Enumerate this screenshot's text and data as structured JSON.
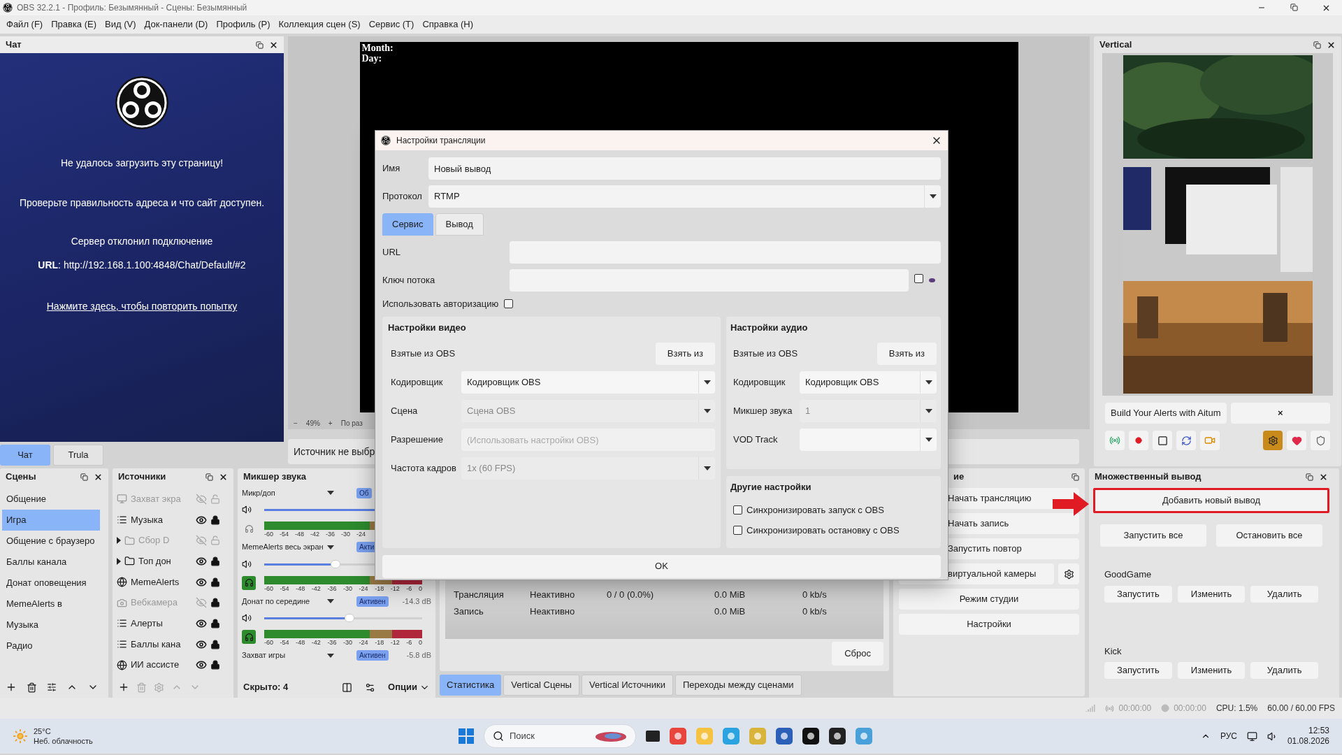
{
  "window": {
    "title": "OBS 32.2.1 - Профиль: Безымянный - Сцены: Безымянный"
  },
  "menu": [
    "Файл (F)",
    "Правка (E)",
    "Вид (V)",
    "Док-панели (D)",
    "Профиль (P)",
    "Коллекция сцен (S)",
    "Сервис (T)",
    "Справка (H)"
  ],
  "chat_dock": {
    "title": "Чат",
    "error_title": "Не удалось загрузить эту страницу!",
    "hint": "Проверьте правильность адреса и что сайт доступен.",
    "error": "Сервер отклонил подключение",
    "url": "**URL**: http://192.168.1.100:4848/Chat/Default/#2",
    "retry_link": "Нажмите здесь, чтобы повторить попытку"
  },
  "dock_tabs": [
    {
      "label": "Чат",
      "selected": true
    },
    {
      "label": "Trula",
      "selected": false
    }
  ],
  "preview": {
    "overlay_lines": [
      "Month:",
      "Day:"
    ],
    "zoom_out": "−",
    "zoom": "49%",
    "zoom_in": "+",
    "fit": "По раз"
  },
  "source_bar": {
    "text": "Источник не выбр"
  },
  "vertical_dock": {
    "title": "Vertical",
    "alerts_button": "Build Your Alerts with Aitum",
    "close_button": "×"
  },
  "scenes": {
    "title": "Сцены",
    "items": [
      {
        "name": "Общение",
        "selected": false
      },
      {
        "name": "Игра",
        "selected": true
      },
      {
        "name": "Общение с браузеро",
        "selected": false
      },
      {
        "name": "Баллы канала",
        "selected": false
      },
      {
        "name": "Донат оповещения",
        "selected": false
      },
      {
        "name": "MemeAlerts в",
        "selected": false
      },
      {
        "name": "Музыка",
        "selected": false
      },
      {
        "name": "Радио",
        "selected": false
      }
    ]
  },
  "sources": {
    "title": "Источники",
    "items": [
      {
        "name": "Захват экра",
        "kind": "display",
        "group": false,
        "visible": false,
        "locked": false
      },
      {
        "name": "Музыка",
        "kind": "list",
        "group": false,
        "visible": true,
        "locked": true
      },
      {
        "name": "Сбор D",
        "kind": "folder",
        "group": true,
        "visible": false,
        "locked": false
      },
      {
        "name": "Топ дон",
        "kind": "folder",
        "group": true,
        "visible": true,
        "locked": true
      },
      {
        "name": "MemeAlerts",
        "kind": "browser",
        "group": false,
        "visible": true,
        "locked": true
      },
      {
        "name": "Вебкамера",
        "kind": "camera",
        "group": false,
        "visible": false,
        "locked": true
      },
      {
        "name": "Алерты",
        "kind": "list",
        "group": false,
        "visible": true,
        "locked": true
      },
      {
        "name": "Баллы кана",
        "kind": "list",
        "group": false,
        "visible": true,
        "locked": true
      },
      {
        "name": "ИИ ассисте",
        "kind": "browser",
        "group": false,
        "visible": true,
        "locked": true
      }
    ]
  },
  "mixer": {
    "title": "Микшер звука",
    "hidden_count": "Скрыто: 4",
    "options": "Опции",
    "channels": [
      {
        "name": "Микр/доп",
        "badge": "Об",
        "level": 1,
        "monitoring": false,
        "scale": [
          "-60",
          "-54",
          "-48",
          "-42",
          "-36",
          "-30",
          "-24"
        ]
      },
      {
        "name": "MemeAlerts весь экран",
        "badge": "Акти",
        "level": 0.45,
        "monitoring": true,
        "scale": [
          "-60",
          "-54",
          "-48",
          "-42",
          "-36",
          "-30",
          "-24",
          "-18",
          "-12",
          "-6",
          "0"
        ]
      },
      {
        "name": "Донат по середине",
        "badge": "Активен",
        "reading": "-14.3 dB",
        "level": 0.54,
        "monitoring": true,
        "scale": [
          "-60",
          "-54",
          "-48",
          "-42",
          "-36",
          "-30",
          "-24",
          "-18",
          "-12",
          "-6",
          "0"
        ]
      },
      {
        "name": "Захват игры",
        "badge": "Активен",
        "reading": "-5.8 dB"
      }
    ]
  },
  "stats": {
    "rows": [
      {
        "name": "Трансляция",
        "status": "Неактивно",
        "frames": "0 / 0 (0.0%)",
        "size": "0.0 MiB",
        "bitrate": "0 kb/s"
      },
      {
        "name": "Запись",
        "status": "Неактивно",
        "size": "0.0 MiB",
        "bitrate": "0 kb/s"
      }
    ],
    "reset": "Сброс"
  },
  "bottom_tabs": [
    {
      "label": "Статистика",
      "selected": true
    },
    {
      "label": "Vertical Сцены",
      "selected": false
    },
    {
      "label": "Vertical Источники",
      "selected": false
    },
    {
      "label": "Переходы между сценами",
      "selected": false
    }
  ],
  "controls": {
    "title": "ие",
    "buttons": [
      "Начать трансляцию",
      "Начать запись",
      "Запустить повтор",
      "виртуальной камеры",
      "Режим студии",
      "Настройки"
    ]
  },
  "multi_output": {
    "title": "Множественный вывод",
    "add_button": "Добавить новый вывод",
    "start_all": "Запустить все",
    "stop_all": "Остановить все",
    "outputs": [
      {
        "name": "GoodGame",
        "buttons": [
          "Запустить",
          "Изменить",
          "Удалить"
        ]
      },
      {
        "name": "Kick",
        "buttons": [
          "Запустить",
          "Изменить",
          "Удалить"
        ]
      }
    ]
  },
  "status_bar": {
    "stream_time": "00:00:00",
    "record_time": "00:00:00",
    "cpu": "CPU: 1.5%",
    "fps": "60.00 / 60.00 FPS"
  },
  "taskbar": {
    "temperature": "25°C",
    "weather": "Неб. облачность",
    "search_placeholder": "Поиск",
    "language": "РУС",
    "time": "12:53",
    "date": "01.08.2026"
  },
  "dialog": {
    "title": "Настройки трансляции",
    "name_label": "Имя",
    "name_value": "Новый вывод",
    "protocol_label": "Протокол",
    "protocol_value": "RTMP",
    "tabs": [
      {
        "label": "Сервис",
        "selected": true
      },
      {
        "label": "Вывод",
        "selected": false
      }
    ],
    "url_label": "URL",
    "key_label": "Ключ потока",
    "show_key": false,
    "auth_label": "Использовать авторизацию",
    "auth_checked": false,
    "video": {
      "title": "Настройки видео",
      "rows": [
        {
          "kind": "button",
          "label": "Взятые из OBS",
          "button": "Взять из"
        },
        {
          "kind": "select",
          "label": "Кодировщик",
          "value": "Кодировщик OBS",
          "disabled": false
        },
        {
          "kind": "select",
          "label": "Сцена",
          "value": "Сцена OBS",
          "disabled": true
        },
        {
          "kind": "input",
          "label": "Разрешение",
          "placeholder": "(Использовать настройки OBS)"
        },
        {
          "kind": "select",
          "label": "Частота кадров",
          "value": "1x (60 FPS)",
          "disabled": true
        }
      ]
    },
    "audio": {
      "title": "Настройки аудио",
      "rows": [
        {
          "kind": "button",
          "label": "Взятые из OBS",
          "button": "Взять из"
        },
        {
          "kind": "select",
          "label": "Кодировщик",
          "value": "Кодировщик OBS",
          "disabled": false
        },
        {
          "kind": "select",
          "label": "Микшер звука",
          "value": "1",
          "disabled": true
        },
        {
          "kind": "select",
          "label": "VOD Track"
        }
      ]
    },
    "other": {
      "title": "Другие настройки",
      "options": [
        {
          "label": "Синхронизировать запуск с OBS",
          "checked": false
        },
        {
          "label": "Синхронизировать остановку с OBS",
          "checked": false
        }
      ]
    },
    "ok": "OK"
  }
}
